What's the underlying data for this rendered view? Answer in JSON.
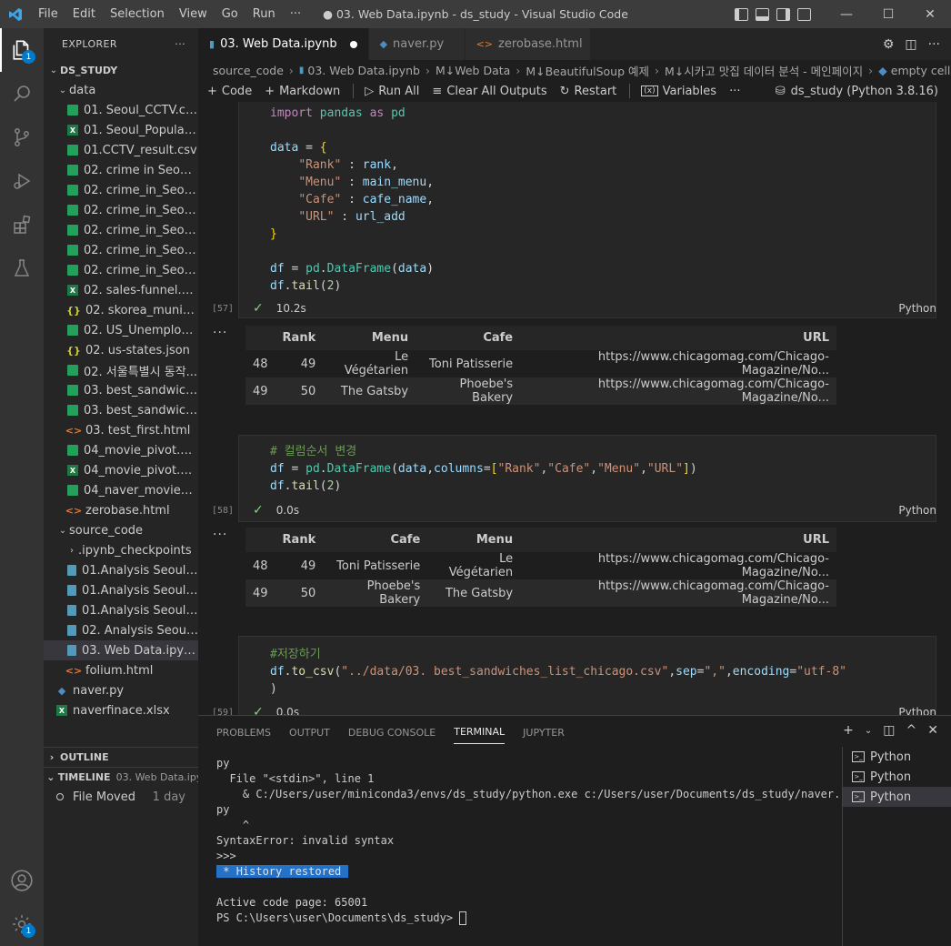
{
  "titlebar": {
    "menus": [
      "File",
      "Edit",
      "Selection",
      "View",
      "Go",
      "Run",
      "···"
    ],
    "title": "● 03. Web Data.ipynb - ds_study - Visual Studio Code"
  },
  "activity": {
    "explorer_badge": "1",
    "settings_badge": "1"
  },
  "sidebar": {
    "header": "EXPLORER",
    "more": "···",
    "root": "DS_STUDY",
    "data_folder": "data",
    "data_files": [
      {
        "name": "01. Seoul_CCTV.csv",
        "type": "csv"
      },
      {
        "name": "01. Seoul_Populatio...",
        "type": "xls"
      },
      {
        "name": "01.CCTV_result.csv",
        "type": "csv"
      },
      {
        "name": "02. crime in Seoul_fi...",
        "type": "csv"
      },
      {
        "name": "02. crime_in_Seoul_1...",
        "type": "csv"
      },
      {
        "name": "02. crime_in_Seoul_fi...",
        "type": "csv"
      },
      {
        "name": "02. crime_in_Seoul_l...",
        "type": "csv"
      },
      {
        "name": "02. crime_in_Seoul_r...",
        "type": "csv"
      },
      {
        "name": "02. crime_in_Seoul.csv",
        "type": "csv"
      },
      {
        "name": "02. sales-funnel.xlsx",
        "type": "xls"
      },
      {
        "name": "02. skorea_municipa...",
        "type": "json"
      },
      {
        "name": "02. US_Unemploym...",
        "type": "csv"
      },
      {
        "name": "02. us-states.json",
        "type": "json"
      },
      {
        "name": "02. 서울특별시 동작...",
        "type": "csv"
      },
      {
        "name": "03. best_sandwiches...",
        "type": "csv"
      },
      {
        "name": "03. best_sandwiches...",
        "type": "csv"
      },
      {
        "name": "03. test_first.html",
        "type": "html"
      },
      {
        "name": "04_movie_pivot.csv",
        "type": "csv"
      },
      {
        "name": "04_movie_pivot.xlsx",
        "type": "xls"
      },
      {
        "name": "04_naver_movie_raw...",
        "type": "csv"
      },
      {
        "name": "zerobase.html",
        "type": "html"
      }
    ],
    "source_folder": "source_code",
    "checkpoints": ".ipynb_checkpoints",
    "source_files": [
      {
        "name": "01.Analysis Seoul CC...",
        "type": "nb"
      },
      {
        "name": "01.Analysis Seoul CC...",
        "type": "nb"
      },
      {
        "name": "01.Analysis Seoul CC...",
        "type": "nb"
      },
      {
        "name": "02. Analysis Seoul Cr...",
        "type": "nb"
      },
      {
        "name": "03. Web Data.ipynb",
        "type": "nb"
      },
      {
        "name": "folium.html",
        "type": "html"
      }
    ],
    "root_files": [
      {
        "name": "naver.py",
        "type": "py"
      },
      {
        "name": "naverfinace.xlsx",
        "type": "xls"
      }
    ],
    "outline": "OUTLINE",
    "timeline": "TIMELINE",
    "timeline_file": "03. Web Data.ipy...",
    "timeline_event": "File Moved",
    "timeline_time": "1 day"
  },
  "tabs": [
    {
      "label": "03. Web Data.ipynb",
      "active": true,
      "dirty": true
    },
    {
      "label": "naver.py",
      "active": false
    },
    {
      "label": "zerobase.html",
      "active": false
    }
  ],
  "breadcrumb": [
    "source_code",
    "03. Web Data.ipynb",
    "M↓Web Data",
    "M↓BeautifulSoup 예제",
    "M↓시카고 맛집 데이터 분석 - 메인페이지",
    "empty cell"
  ],
  "nbtoolbar": {
    "code": "Code",
    "markdown": "Markdown",
    "run_all": "Run All",
    "clear": "Clear All Outputs",
    "restart": "Restart",
    "variables": "Variables",
    "more": "···",
    "kernel": "ds_study (Python 3.8.16)"
  },
  "cells": {
    "c57": {
      "exec": "[57]",
      "time": "10.2s",
      "lang": "Python",
      "table": {
        "columns": [
          "",
          "Rank",
          "Menu",
          "Cafe",
          "URL"
        ],
        "rows": [
          [
            "48",
            "49",
            "Le Végétarien",
            "Toni Patisserie",
            "https://www.chicagomag.com/Chicago-Magazine/No..."
          ],
          [
            "49",
            "50",
            "The Gatsby",
            "Phoebe's Bakery",
            "https://www.chicagomag.com/Chicago-Magazine/No..."
          ]
        ]
      }
    },
    "c58": {
      "comment": "# 컬럼순서 변경",
      "exec": "[58]",
      "time": "0.0s",
      "lang": "Python",
      "table": {
        "columns": [
          "",
          "Rank",
          "Cafe",
          "Menu",
          "URL"
        ],
        "rows": [
          [
            "48",
            "49",
            "Toni Patisserie",
            "Le Végétarien",
            "https://www.chicagomag.com/Chicago-Magazine/No..."
          ],
          [
            "49",
            "50",
            "Phoebe's Bakery",
            "The Gatsby",
            "https://www.chicagomag.com/Chicago-Magazine/No..."
          ]
        ]
      }
    },
    "c59": {
      "comment": "#저장하기",
      "exec": "[59]",
      "time": "0.0s",
      "lang": "Python"
    }
  },
  "panel": {
    "tabs": [
      "PROBLEMS",
      "OUTPUT",
      "DEBUG CONSOLE",
      "TERMINAL",
      "JUPYTER"
    ],
    "active_tab": "TERMINAL",
    "terminal_lines": [
      "py",
      "  File \"<stdin>\", line 1",
      "    & C:/Users/user/miniconda3/envs/ds_study/python.exe c:/Users/user/Documents/ds_study/naver.",
      "py",
      "    ^",
      "SyntaxError: invalid syntax",
      ">>>"
    ],
    "history": "History restored",
    "code_page": "Active code page: 65001",
    "prompt": "PS C:\\Users\\user\\Documents\\ds_study> ",
    "terminals": [
      "Python",
      "Python",
      "Python"
    ]
  }
}
